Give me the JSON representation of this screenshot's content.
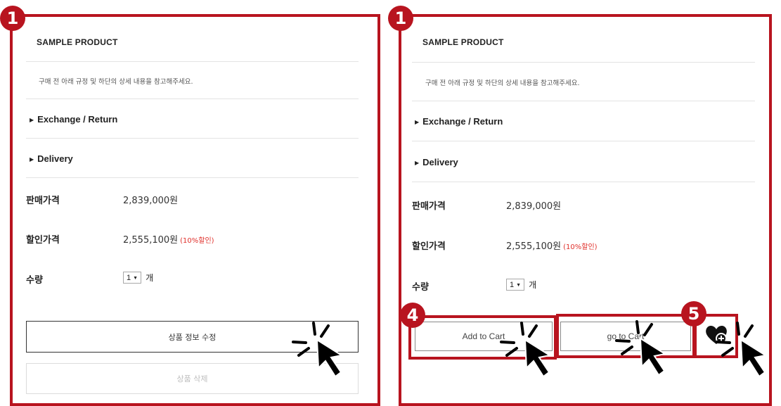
{
  "left_panel": {
    "step_badge": "1",
    "product_title": "SAMPLE PRODUCT",
    "notice": "구매 전 아래 규정 및 하단의 상세 내용을 참고해주세요.",
    "accordions": [
      {
        "label": "Exchange / Return"
      },
      {
        "label": "Delivery"
      }
    ],
    "sale_price_label": "판매가격",
    "sale_price": "2,839,000원",
    "discount_price_label": "할인가격",
    "discount_price": "2,555,100원",
    "discount_note": "(10%할인)",
    "quantity_label": "수량",
    "quantity_value": "1",
    "quantity_unit": "개",
    "edit_button": "상품 정보 수정",
    "delete_button": "상품 삭제"
  },
  "right_panel": {
    "step_badge": "1",
    "product_title": "SAMPLE PRODUCT",
    "notice": "구매 전 아래 규정 및 하단의 상세 내용을 참고해주세요.",
    "accordions": [
      {
        "label": "Exchange / Return"
      },
      {
        "label": "Delivery"
      }
    ],
    "sale_price_label": "판매가격",
    "sale_price": "2,839,000원",
    "discount_price_label": "할인가격",
    "discount_price": "2,555,100원",
    "discount_note": "(10%할인)",
    "quantity_label": "수량",
    "quantity_value": "1",
    "quantity_unit": "개",
    "add_to_cart_button": "Add to Cart",
    "go_to_cart_button": "go to Cart",
    "step_badge_cart": "4",
    "step_badge_wishlist": "5",
    "wishlist_icon": "heart-plus-icon"
  },
  "colors": {
    "highlight": "#b8141f",
    "discount": "#e0302b"
  },
  "icons": {
    "cursor": "click-cursor-icon",
    "accordion_toggle": "triangle-right-icon",
    "select_arrow": "triangle-down-icon"
  }
}
